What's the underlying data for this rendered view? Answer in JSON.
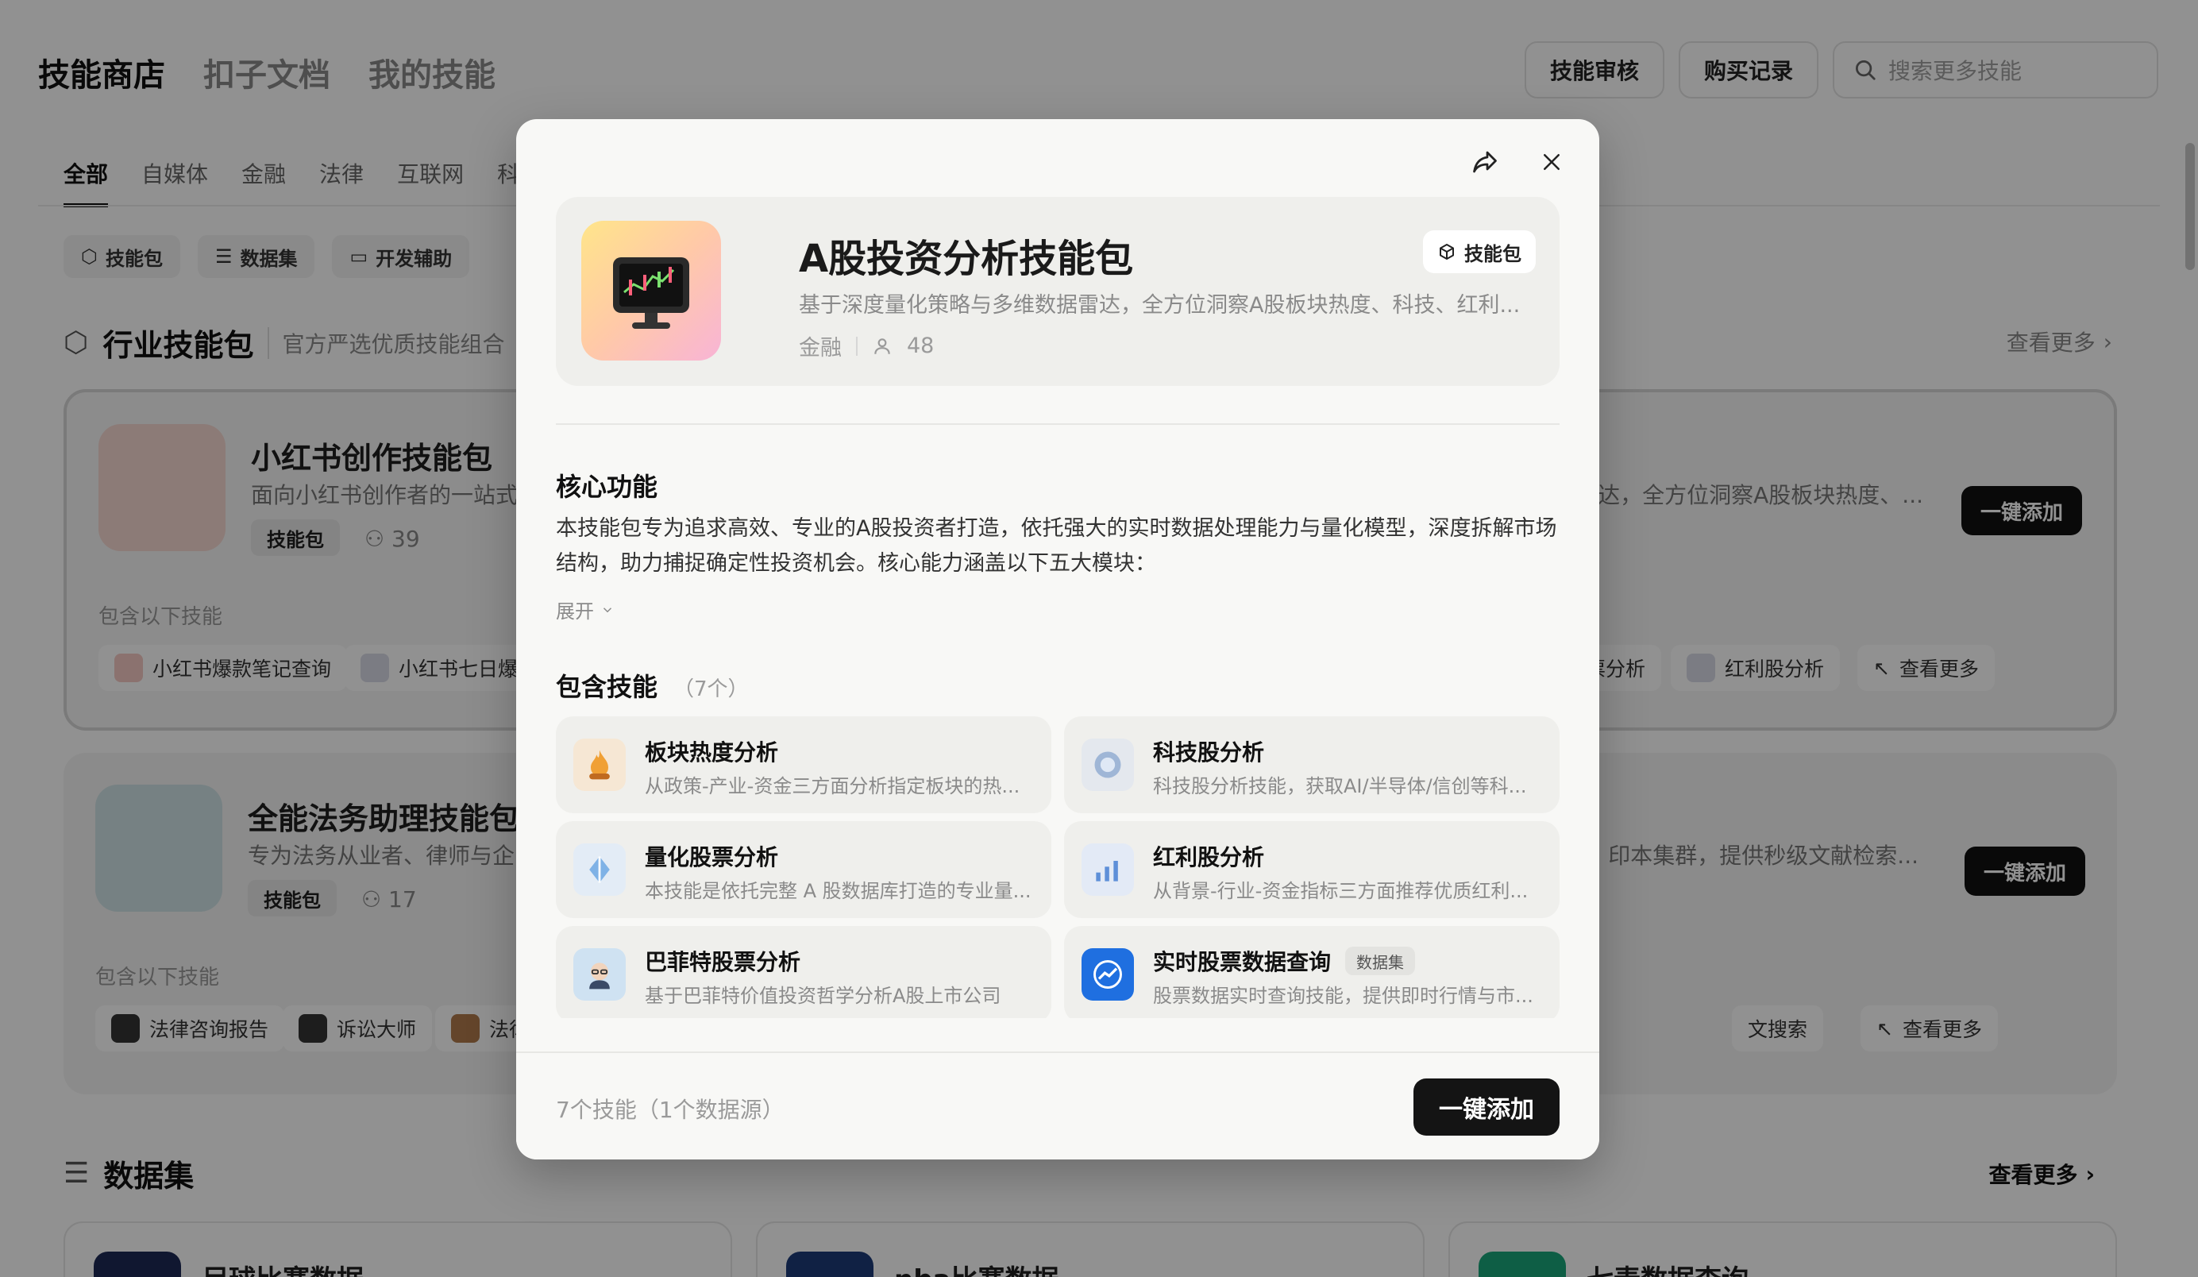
{
  "header": {
    "tabs": [
      "技能商店",
      "扣子文档",
      "我的技能"
    ],
    "review_button": "技能审核",
    "purchase_button": "购买记录",
    "search_placeholder": "搜索更多技能"
  },
  "categories": [
    "全部",
    "自媒体",
    "金融",
    "法律",
    "互联网",
    "科"
  ],
  "chips": [
    "技能包",
    "数据集",
    "开发辅助"
  ],
  "industry_section": {
    "title": "行业技能包",
    "subtitle": "官方严选优质技能组合",
    "see_more": "查看更多",
    "cards": [
      {
        "name": "小红书创作技能包",
        "desc": "面向小红书创作者的一站式",
        "tag": "技能包",
        "users": "39",
        "right_desc": "达，全方位洞察A股板块热度、...",
        "includes_label": "包含以下技能",
        "skills": [
          "小红书爆款笔记查询",
          "小红书七日爆款"
        ],
        "right_skills": [
          "票分析",
          "红利股分析",
          "查看更多"
        ],
        "add_label": "一键添加"
      },
      {
        "name": "全能法务助理技能包",
        "desc": "专为法务从业者、律师与企",
        "tag": "技能包",
        "users": "17",
        "right_desc": "印本集群，提供秒级文献检索...",
        "includes_label": "包含以下技能",
        "skills": [
          "法律咨询报告",
          "诉讼大师",
          "法律"
        ],
        "right_skills": [
          "文搜索",
          "查看更多"
        ],
        "add_label": "一键添加"
      }
    ]
  },
  "dataset_section": {
    "title": "数据集",
    "see_more": "查看更多",
    "items": [
      "足球比赛数据",
      "nba比赛数据",
      "七麦数据查询"
    ]
  },
  "modal": {
    "title": "A股投资分析技能包",
    "badge": "技能包",
    "description": "基于深度量化策略与多维数据雷达，全方位洞察A股板块热度、科技、红利...",
    "category": "金融",
    "users": "48",
    "core_heading": "核心功能",
    "core_text": "本技能包专为追求高效、专业的A股投资者打造，依托强大的实时数据处理能力与量化模型，深度拆解市场结构，助力捕捉确定性投资机会。核心能力涵盖以下五大模块：",
    "expand_label": "展开",
    "includes_heading": "包含技能",
    "includes_count": "（7个）",
    "skills": [
      {
        "name": "板块热度分析",
        "desc": "从政策-产业-资金三方面分析指定板块的热...",
        "tag": ""
      },
      {
        "name": "科技股分析",
        "desc": "科技股分析技能，获取AI/半导体/信创等科...",
        "tag": ""
      },
      {
        "name": "量化股票分析",
        "desc": "本技能是依托完整 A 股数据库打造的专业量...",
        "tag": ""
      },
      {
        "name": "红利股分析",
        "desc": "从背景-行业-资金指标三方面推荐优质红利...",
        "tag": ""
      },
      {
        "name": "巴菲特股票分析",
        "desc": "基于巴菲特价值投资哲学分析A股上市公司",
        "tag": ""
      },
      {
        "name": "实时股票数据查询",
        "desc": "股票数据实时查询技能，提供即时行情与市...",
        "tag": "数据集"
      }
    ],
    "footer_note": "7个技能（1个数据源）",
    "footer_button": "一键添加"
  }
}
